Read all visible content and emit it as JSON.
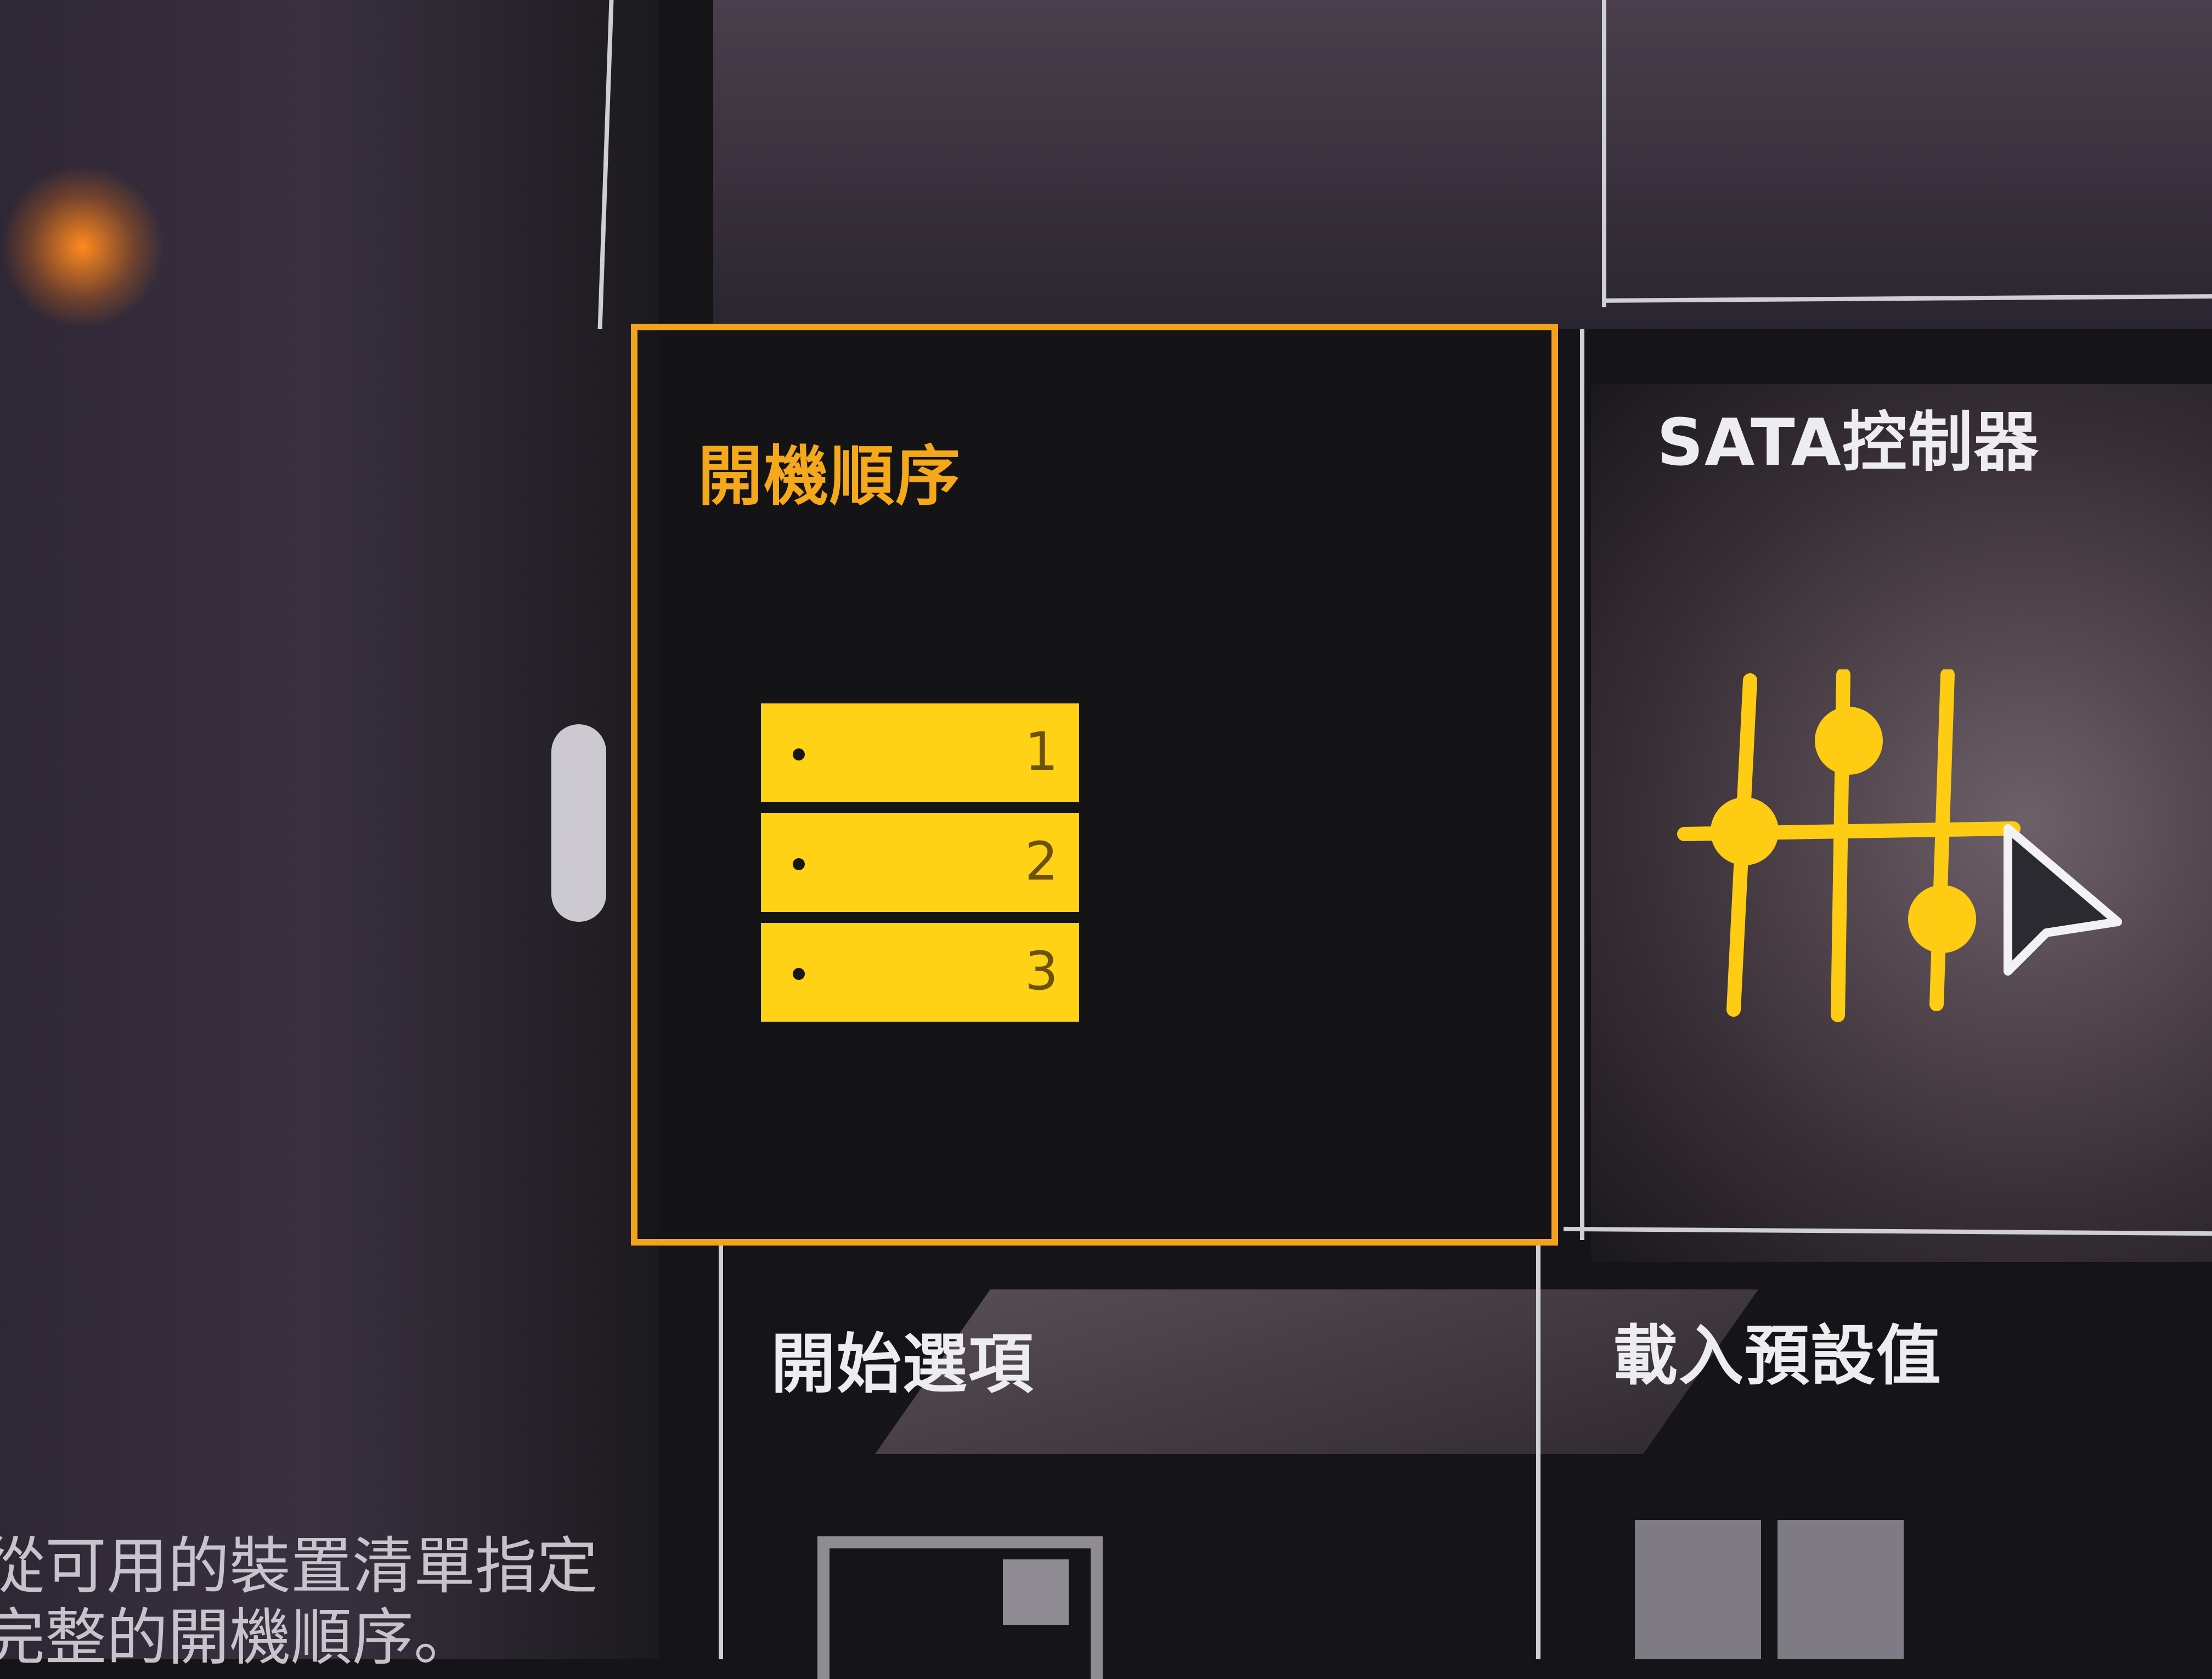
{
  "tiles": {
    "boot_order": {
      "title": "開機順序",
      "items": [
        "1",
        "2",
        "3"
      ],
      "selected": true,
      "accent": "#f2a21c"
    },
    "sata": {
      "title": "SATA控制器"
    },
    "start_options": {
      "title": "開始選項"
    },
    "load_defaults": {
      "title": "載入預設值"
    }
  },
  "description": {
    "line1": "從可用的裝置清單指定",
    "line2": "完整的開機順序。"
  },
  "icons": [
    "boot-order-icon",
    "sata-controller-icon",
    "start-options-icon",
    "load-defaults-icon",
    "mouse-pointer-icon"
  ],
  "colors": {
    "accent": "#f2a21c",
    "icon_yellow": "#ffd216",
    "text": "#ededf0"
  }
}
